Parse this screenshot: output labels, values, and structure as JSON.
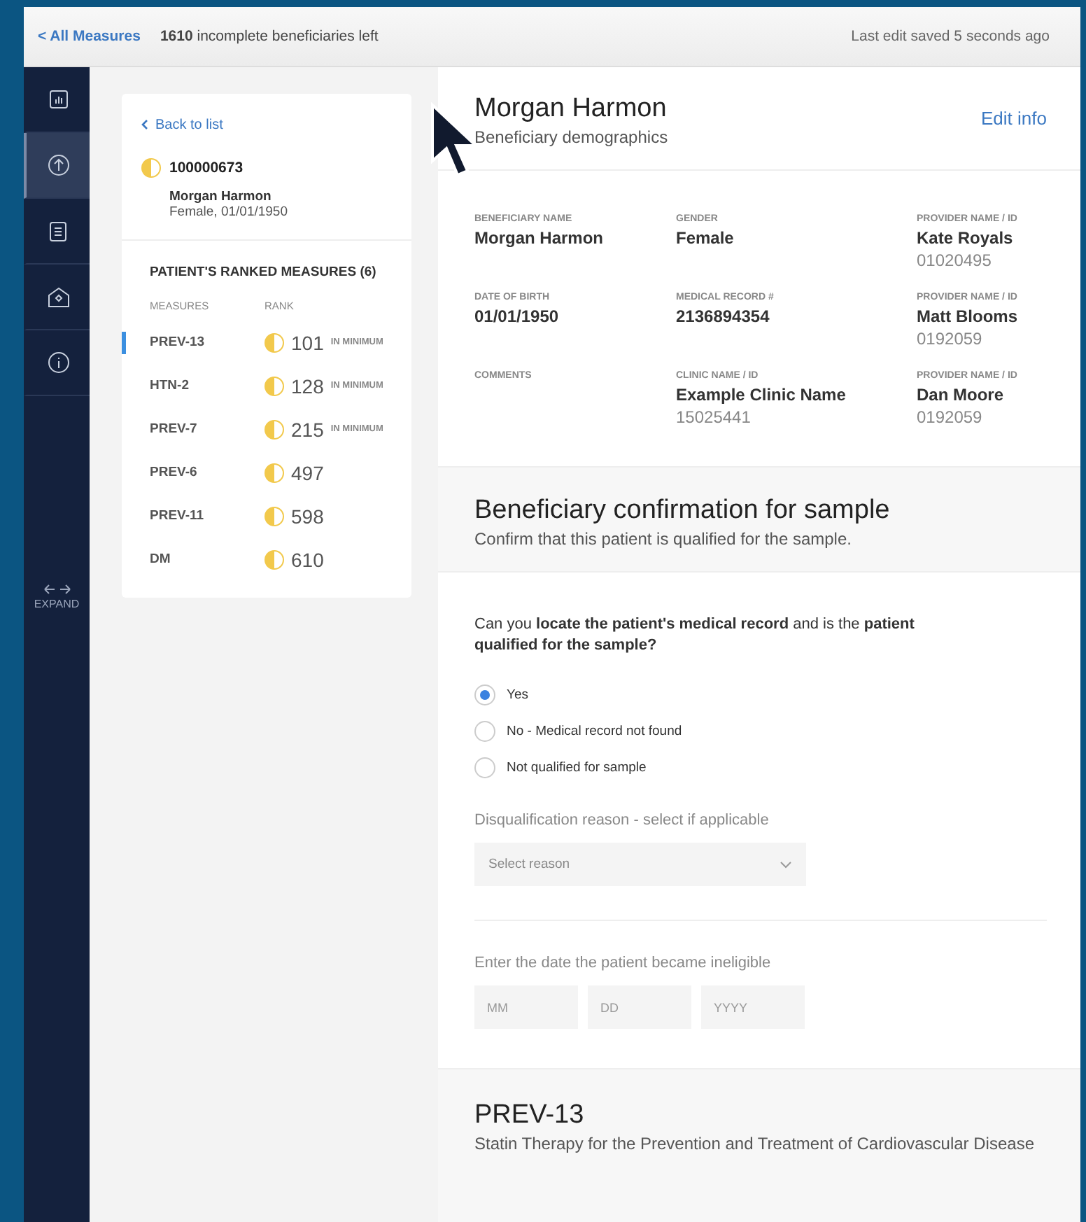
{
  "top_bar": {
    "back_link": "< All Measures",
    "count": "1610",
    "count_text": "incomplete beneficiaries left",
    "saved": "Last edit saved 5 seconds ago"
  },
  "nav": {
    "items": [
      {
        "selected": false
      },
      {
        "selected": true
      },
      {
        "selected": false
      },
      {
        "selected": false
      },
      {
        "selected": false
      }
    ],
    "expand": "EXPAND"
  },
  "patient_card": {
    "back": "Back to list",
    "id": "100000673",
    "name": "Morgan Harmon",
    "details": "Female, 01/01/1950",
    "measures_title": "PATIENT'S RANKED MEASURES (6)",
    "columns": [
      "MEASURES",
      "RANK"
    ],
    "measures": [
      {
        "name": "PREV-13",
        "rank": "101",
        "note": "IN MINIMUM",
        "selected": true
      },
      {
        "name": "HTN-2",
        "rank": "128",
        "note": "IN MINIMUM",
        "selected": false
      },
      {
        "name": "PREV-7",
        "rank": "215",
        "note": "IN MINIMUM",
        "selected": false
      },
      {
        "name": "PREV-6",
        "rank": "497",
        "selected": false
      },
      {
        "name": "PREV-11",
        "rank": "598",
        "selected": false
      },
      {
        "name": "DM",
        "rank": "610",
        "selected": false
      }
    ]
  },
  "demographics": {
    "title": "Morgan Harmon",
    "subtitle": "Beneficiary demographics",
    "edit": "Edit info",
    "fields": [
      {
        "label": "BENEFICIARY NAME",
        "value": "Morgan Harmon"
      },
      {
        "label": "GENDER",
        "value": "Female"
      },
      {
        "label": "PROVIDER NAME / ID",
        "value": "Kate Royals",
        "sub": "01020495"
      },
      {
        "label": "DATE OF BIRTH",
        "value": "01/01/1950"
      },
      {
        "label": "MEDICAL RECORD #",
        "value": "2136894354"
      },
      {
        "label": "PROVIDER NAME / ID",
        "value": "Matt Blooms",
        "sub": "0192059"
      },
      {
        "label": "COMMENTS"
      },
      {
        "label": "CLINIC NAME / ID",
        "value": "Example Clinic Name",
        "sub": "15025441"
      },
      {
        "label": "PROVIDER NAME / ID",
        "value": "Dan Moore",
        "sub": "0192059"
      }
    ]
  },
  "confirmation": {
    "title": "Beneficiary confirmation for sample",
    "subtitle": "Confirm that this patient is qualified for the sample.",
    "question": "Can you **locate the patient's medical record** and is the **patient qualified for the sample?**",
    "options": [
      {
        "label": "Yes",
        "selected": true
      },
      {
        "label": "No - Medical record not found",
        "selected": false
      },
      {
        "label": "Not qualified for sample",
        "selected": false
      }
    ],
    "reason_label": "Disqualification reason - select if applicable",
    "reason_placeholder": "Select reason",
    "date_label": "Enter the date the patient became ineligible",
    "date_placeholders": [
      "MM",
      "DD",
      "YYYY"
    ]
  },
  "measure_section": {
    "title": "PREV-13",
    "subtitle": "Statin Therapy for the Prevention and Treatment of Cardiovascular Disease"
  }
}
